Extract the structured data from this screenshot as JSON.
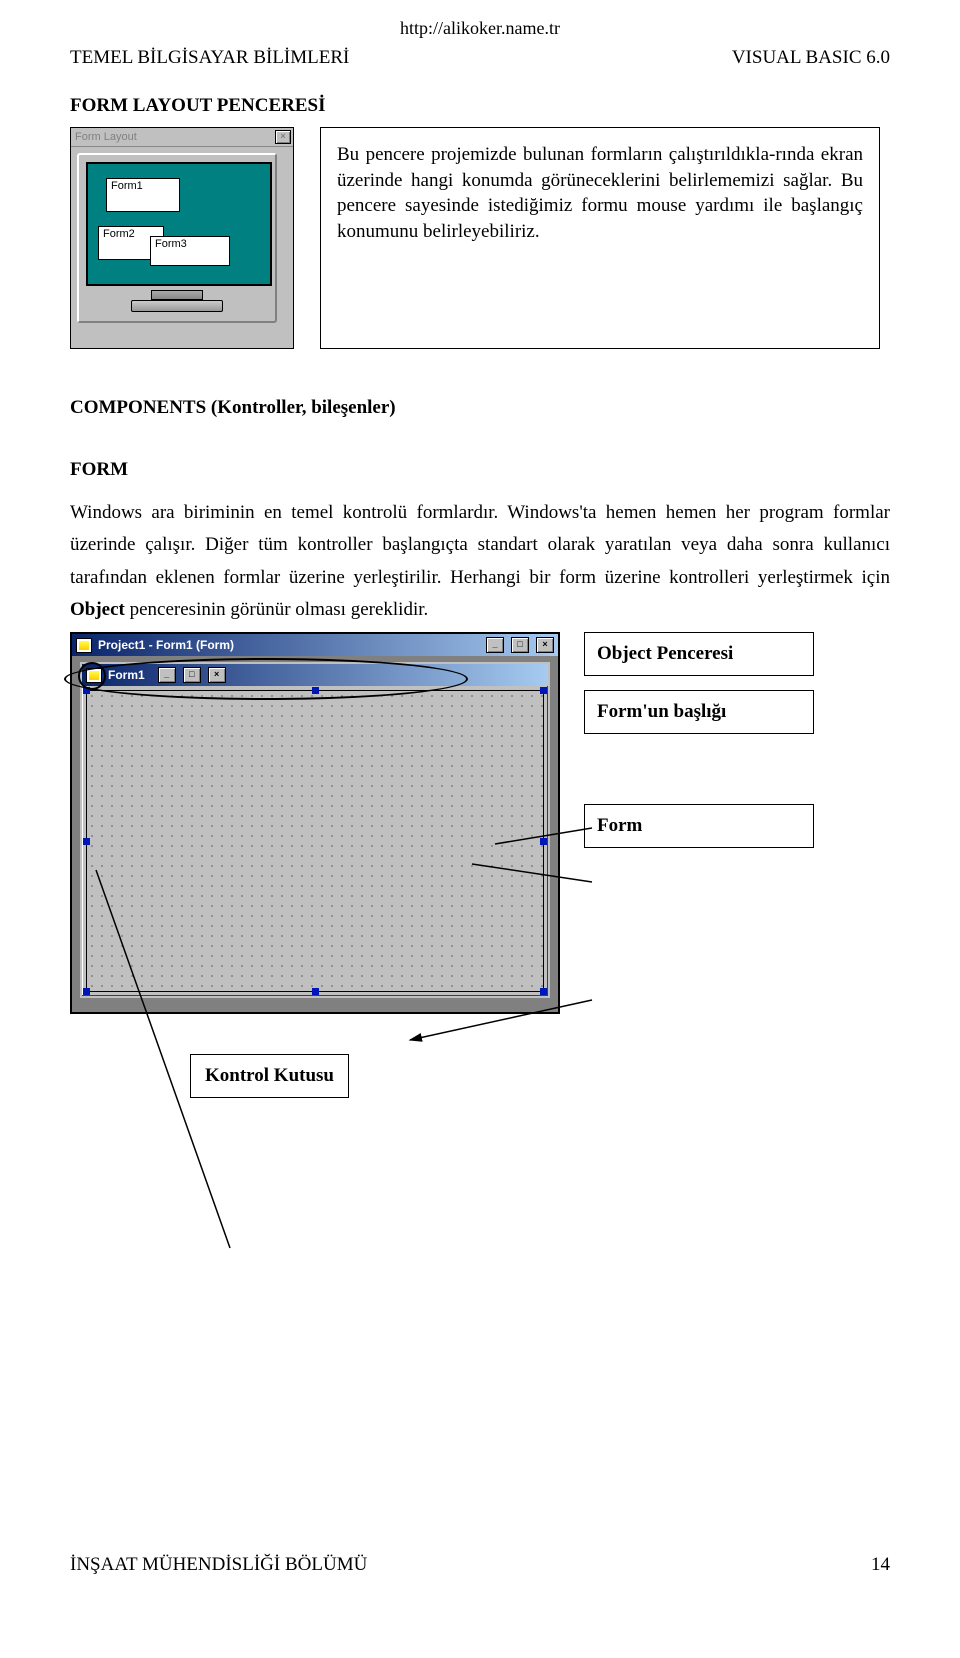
{
  "url": "http://alikoker.name.tr",
  "header": {
    "left": "TEMEL BİLGİSAYAR BİLİMLERİ",
    "right": "VISUAL BASIC 6.0"
  },
  "section1": {
    "title": "FORM LAYOUT PENCERESİ",
    "winTitle": "Form Layout",
    "forms": [
      "Form1",
      "Form2",
      "Form3"
    ],
    "explain": "Bu pencere projemizde bulunan formların çalıştırıldıkla-rında ekran üzerinde hangi konumda görüneceklerini belirlememizi sağlar. Bu pencere sayesinde istediğimiz formu mouse yardımı ile başlangıç konumunu belirleyebiliriz."
  },
  "section2": {
    "title": "COMPONENTS (Kontroller, bileşenler)",
    "formTitle": "FORM",
    "para_before_bold": "Windows ara biriminin en temel kontrolü formlardır. Windows'ta hemen hemen her program formlar üzerinde çalışır. Diğer tüm kontroller başlangıçta standart olarak yaratılan veya daha sonra kullanıcı tarafından eklenen formlar üzerine yerleştirilir. Herhangi bir form üzerine kontrolleri yerleştirmek için ",
    "bold_word": "Object",
    "para_after_bold": "  penceresinin görünür olması gereklidir."
  },
  "objwin": {
    "outerTitle": "Project1 - Form1 (Form)",
    "innerTitle": "Form1"
  },
  "labels": {
    "objectPenceresi": "Object Penceresi",
    "formBaslik": "Form'un başlığı",
    "form": "Form",
    "kontrolKutusu": "Kontrol Kutusu"
  },
  "footer": {
    "left": "İNŞAAT MÜHENDİSLİĞİ BÖLÜMÜ",
    "right": "14"
  }
}
